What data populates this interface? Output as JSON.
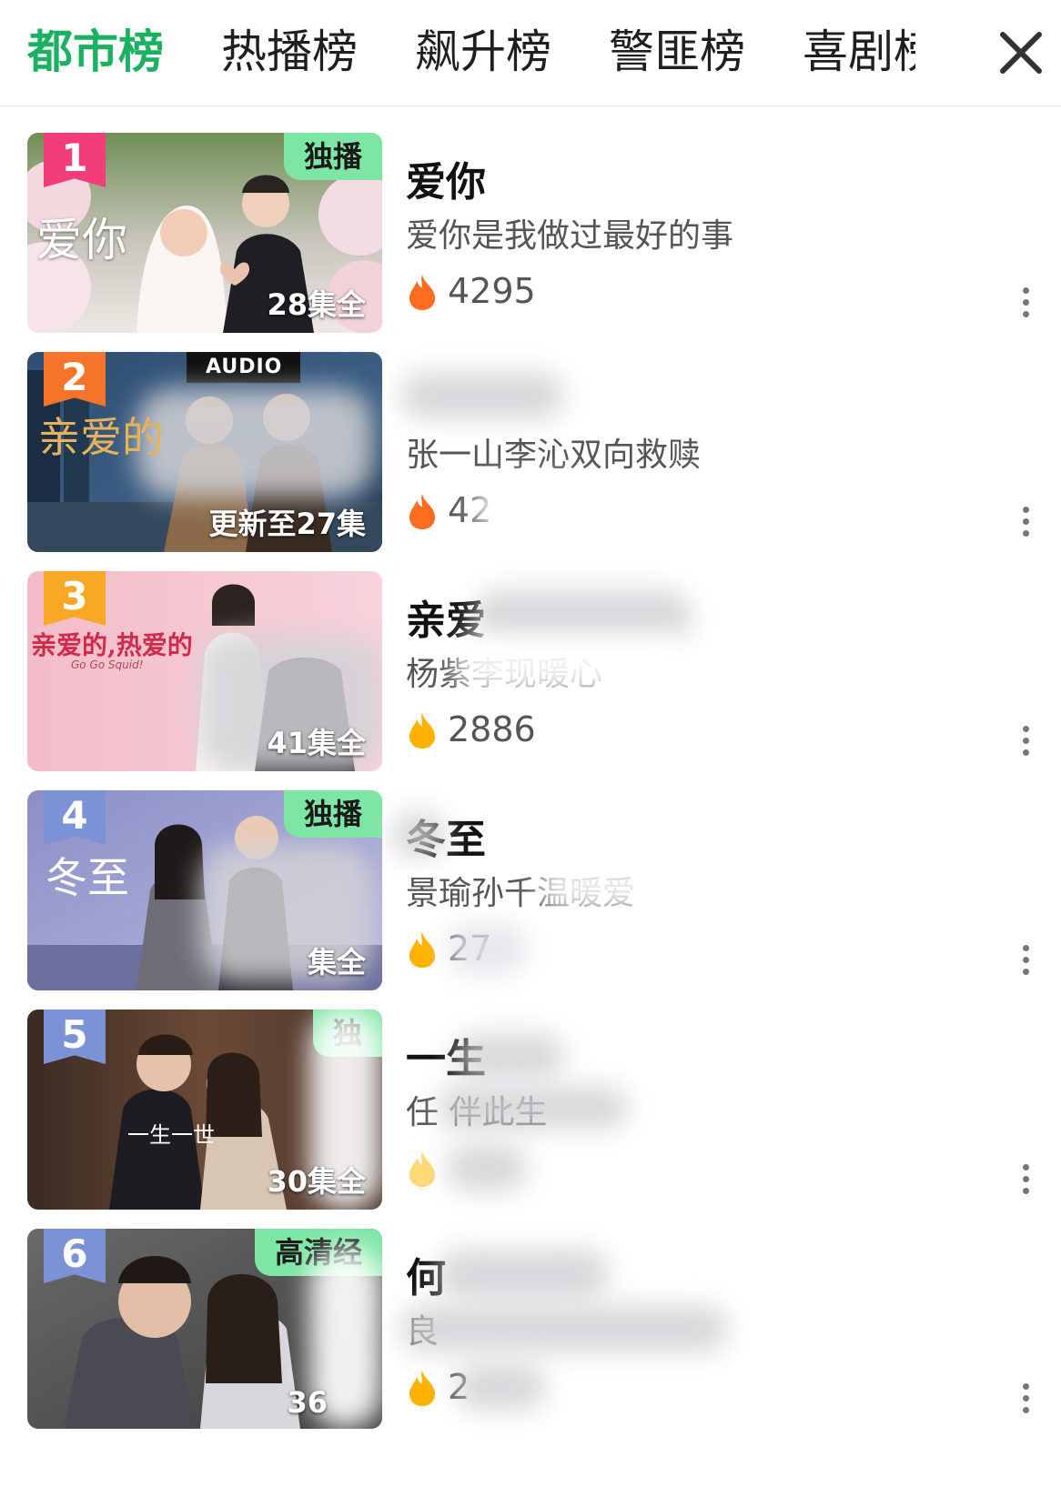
{
  "tabs": [
    {
      "label": "都市榜",
      "active": true
    },
    {
      "label": "热播榜",
      "active": false
    },
    {
      "label": "飙升榜",
      "active": false
    },
    {
      "label": "警匪榜",
      "active": false
    },
    {
      "label": "喜剧榜",
      "active": false
    }
  ],
  "close_icon": "close-icon",
  "colors": {
    "accent": "#1bb161",
    "rank1": "#f23d7a",
    "rank2": "#f5742a",
    "rank3": "#f9a825",
    "rank_other": "#7b93d6",
    "tag_bg": "#7ee6a5",
    "flame_hot": "#ff6d1f",
    "flame_warm": "#ffb300"
  },
  "list": [
    {
      "rank": "1",
      "title": "爱你",
      "desc": "爱你是我做过最好的事",
      "heat": "4295",
      "episodes": "28集全",
      "tag": "独播",
      "poster_text": "爱你",
      "flame_icon": "flame-icon",
      "more_icon": "more-vertical-icon"
    },
    {
      "rank": "2",
      "title": "",
      "desc": "张一山李沁双向救赎",
      "heat": "42",
      "episodes": "更新至27集",
      "tag": "",
      "poster_text": "亲爱的",
      "poster_badge": "AUDIO",
      "flame_icon": "flame-icon",
      "more_icon": "more-vertical-icon"
    },
    {
      "rank": "3",
      "title": "亲爱",
      "desc": "杨紫李现暖心",
      "heat": "2886",
      "episodes": "41集全",
      "tag": "",
      "poster_text": "亲爱的,热爱的",
      "poster_subtext": "Go Go Squid!",
      "flame_icon": "flame-icon",
      "more_icon": "more-vertical-icon"
    },
    {
      "rank": "4",
      "title": "冬至",
      "desc": "景瑜孙千温暖爱",
      "heat": "27",
      "episodes": "集全",
      "tag": "独播",
      "poster_text": "冬至",
      "flame_icon": "flame-icon",
      "more_icon": "more-vertical-icon"
    },
    {
      "rank": "5",
      "title": "一生",
      "desc": "任 伴此生",
      "heat": "",
      "episodes": "30集全",
      "tag": "独",
      "poster_text": "一生一世",
      "flame_icon": "flame-icon",
      "more_icon": "more-vertical-icon"
    },
    {
      "rank": "6",
      "title": "何",
      "desc": "良",
      "heat": "2",
      "episodes": "36",
      "tag": "高清经",
      "flame_icon": "flame-icon",
      "more_icon": "more-vertical-icon"
    }
  ]
}
